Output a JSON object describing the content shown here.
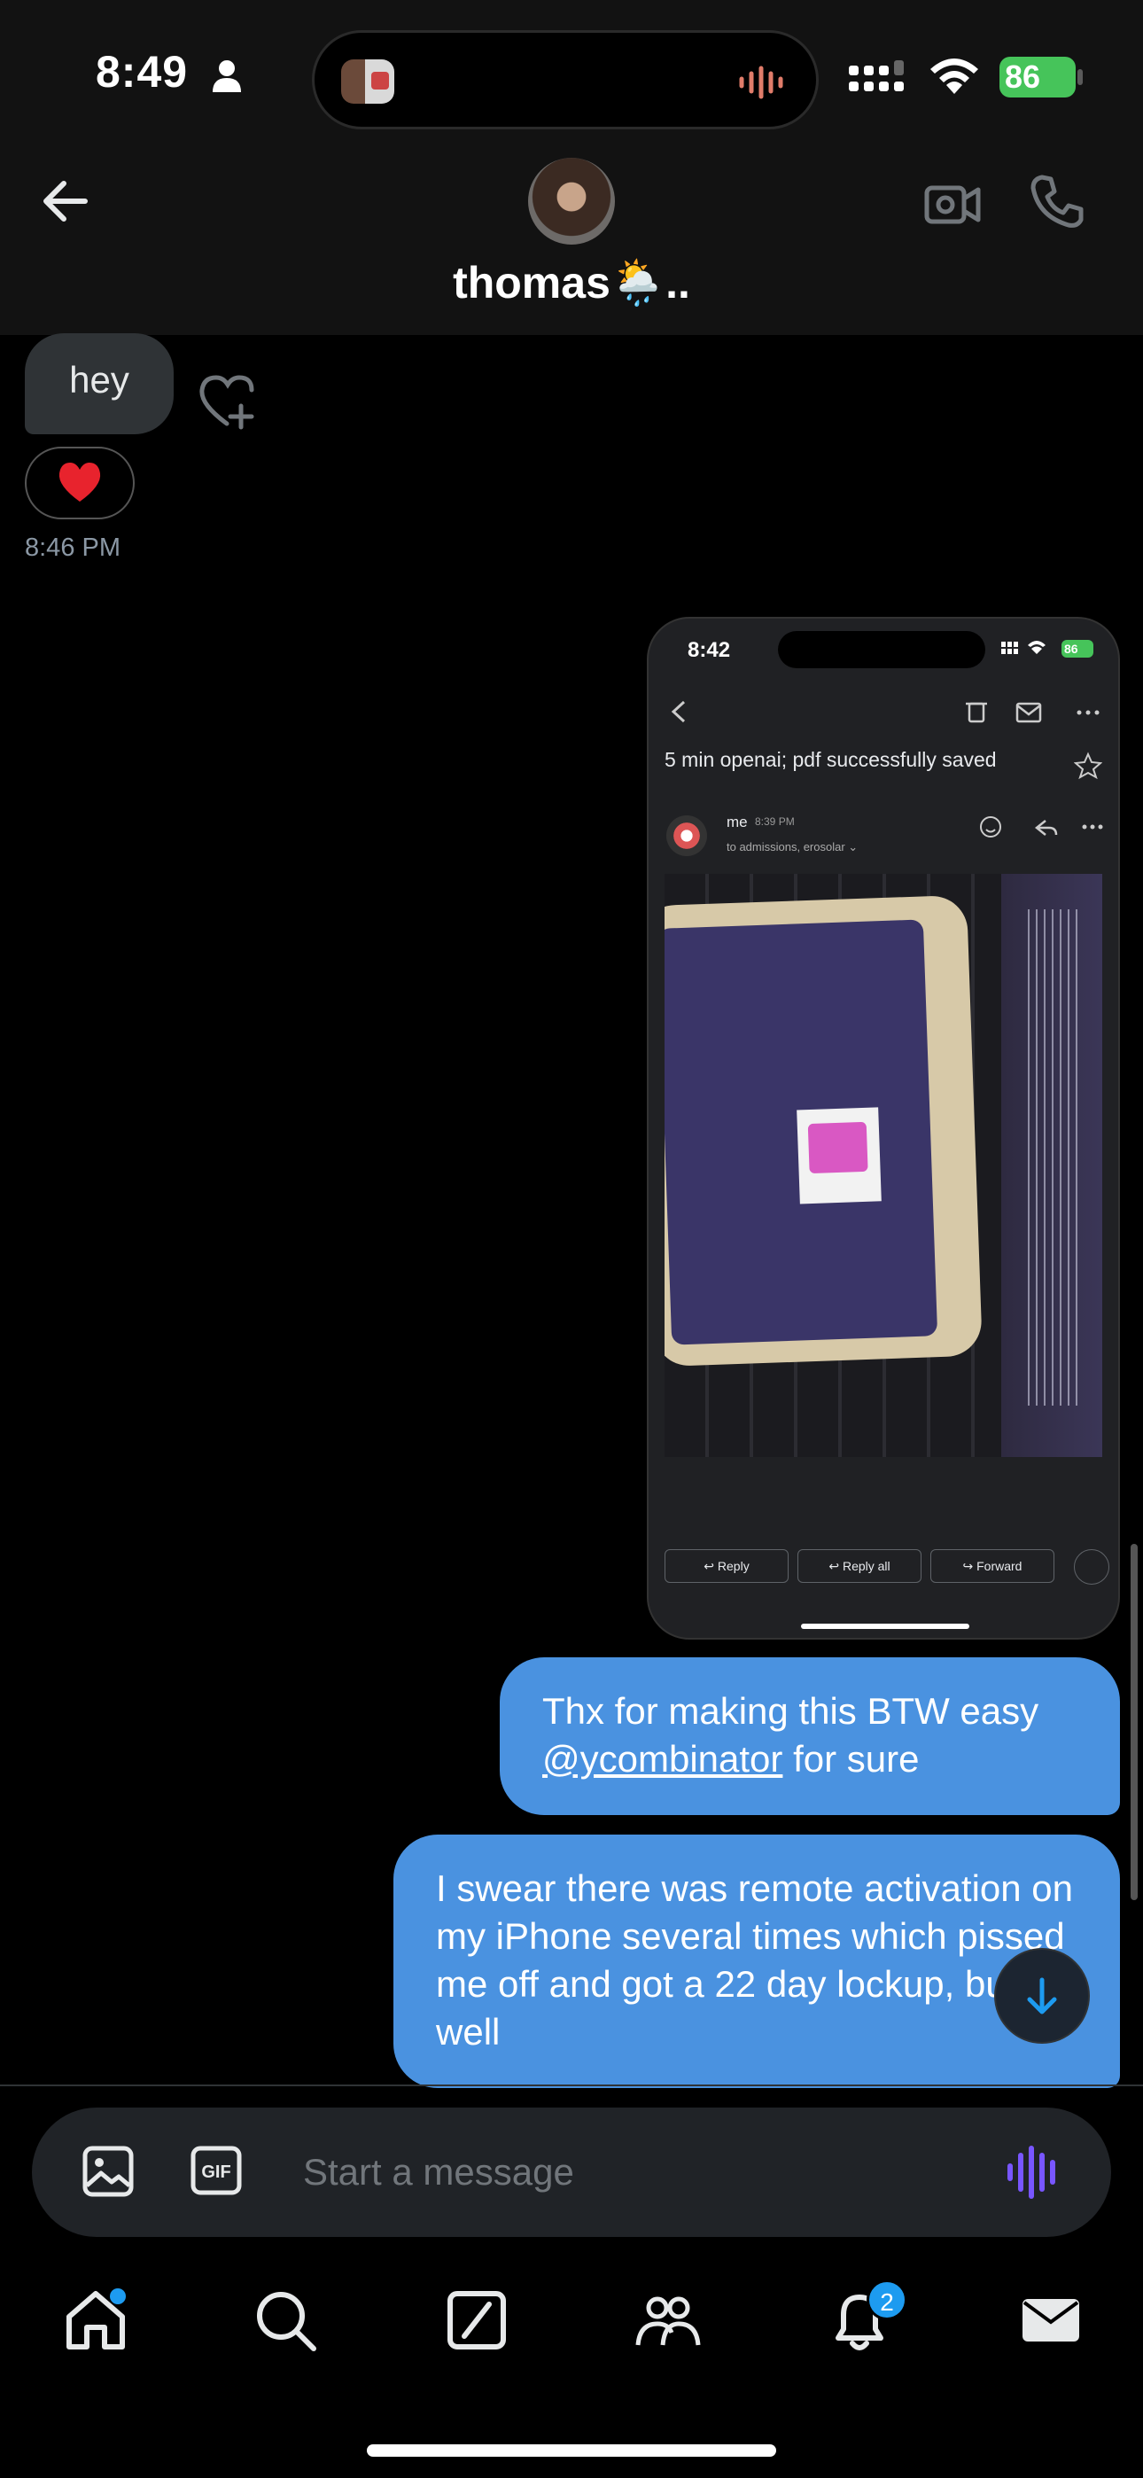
{
  "status_bar": {
    "time": "8:49",
    "battery": "86"
  },
  "header": {
    "contact_name": "thomas🌦️.."
  },
  "messages": {
    "received": {
      "text": "hey",
      "reaction": "❤️",
      "timestamp": "8:46 PM"
    },
    "attachment": {
      "status_time": "8:42",
      "status_battery": "86",
      "email_subject": "5 min openai; pdf successfully saved",
      "sender": "me",
      "sender_time": "8:39 PM",
      "recipients": "to admissions, erosolar ⌄",
      "reply_label": "Reply",
      "reply_all_label": "Reply all",
      "forward_label": "Forward"
    },
    "sent_1": {
      "line1": "Thx for making this BTW easy",
      "mention": "@ycombinator",
      "line2_rest": " for sure"
    },
    "sent_2": {
      "text": "I swear there was remote activation on my iPhone several times which pissed me off and got a 22 day lockup, but oh well"
    }
  },
  "composer": {
    "placeholder": "Start a message"
  },
  "tab_bar": {
    "notification_count": "2"
  },
  "colors": {
    "sent_bubble": "#4a92e0",
    "received_bubble": "#2f3336",
    "accent": "#1d9bf0",
    "voice": "#7856ff"
  }
}
